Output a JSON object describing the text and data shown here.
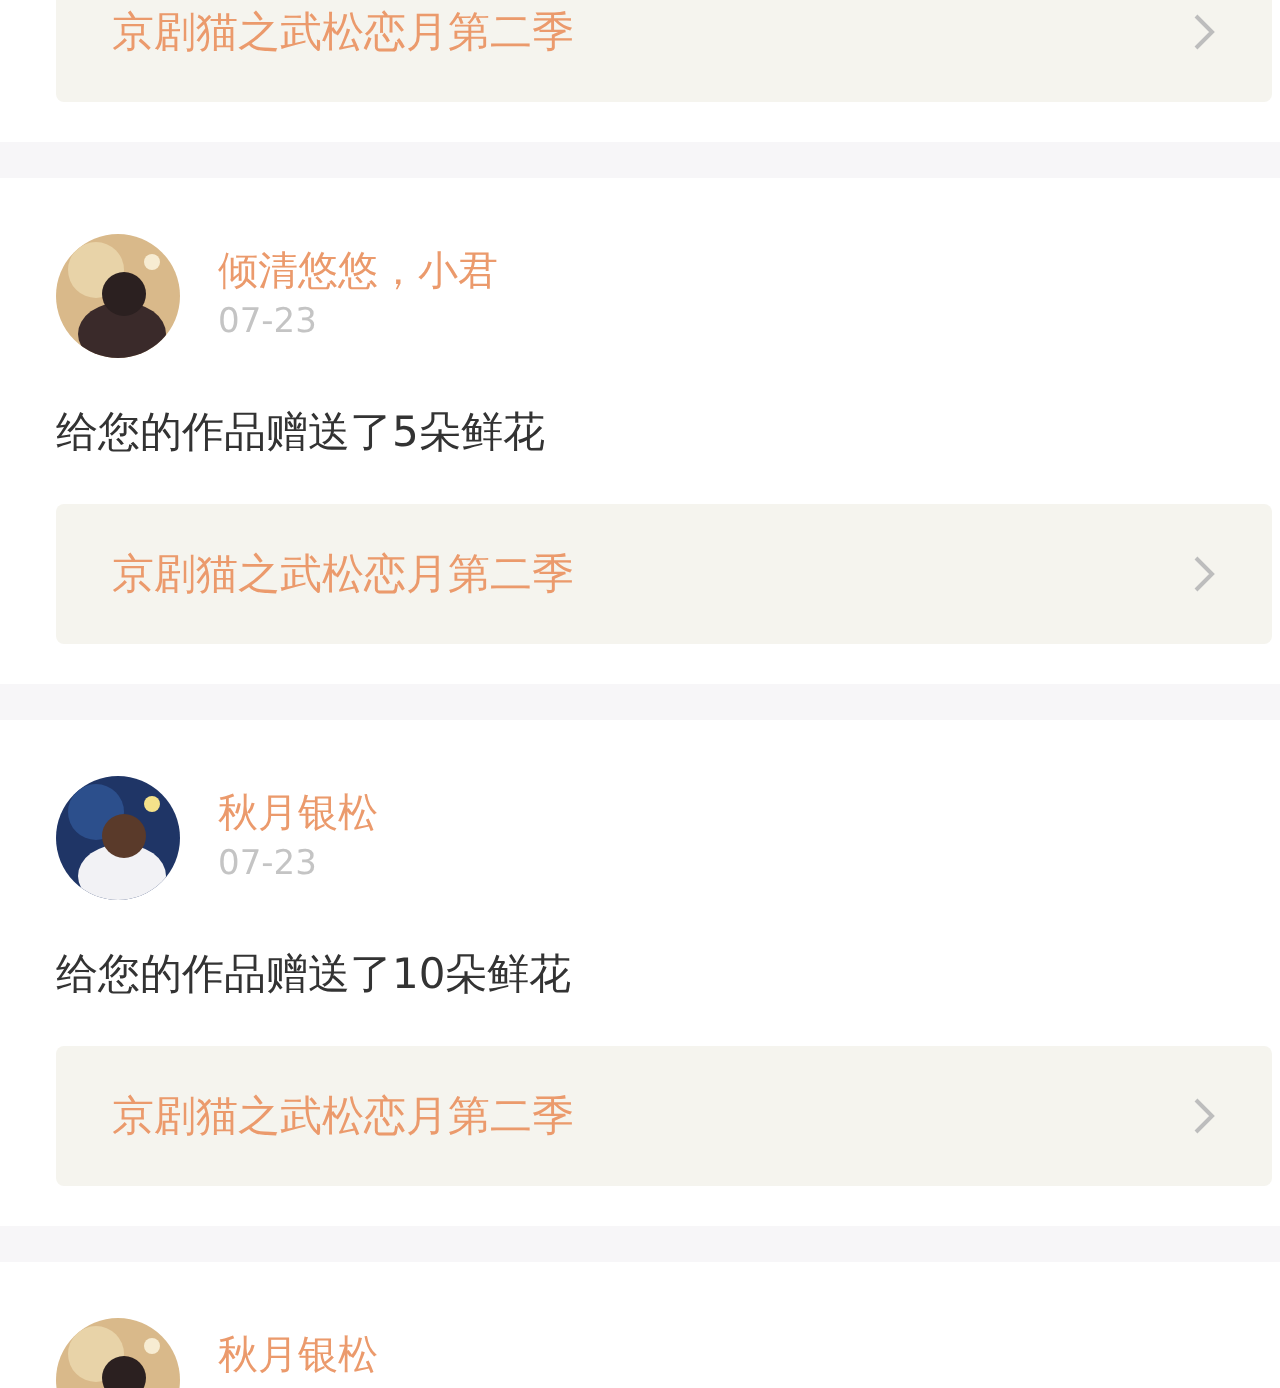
{
  "items": [
    {
      "work": "京剧猫之武松恋月第二季"
    },
    {
      "user": "倾清悠悠，小君",
      "date": "07-23",
      "message": "给您的作品赠送了5朵鲜花",
      "work": "京剧猫之武松恋月第二季"
    },
    {
      "user": "秋月银松",
      "date": "07-23",
      "message": "给您的作品赠送了10朵鲜花",
      "work": "京剧猫之武松恋月第二季"
    },
    {
      "user": "秋月银松"
    }
  ]
}
